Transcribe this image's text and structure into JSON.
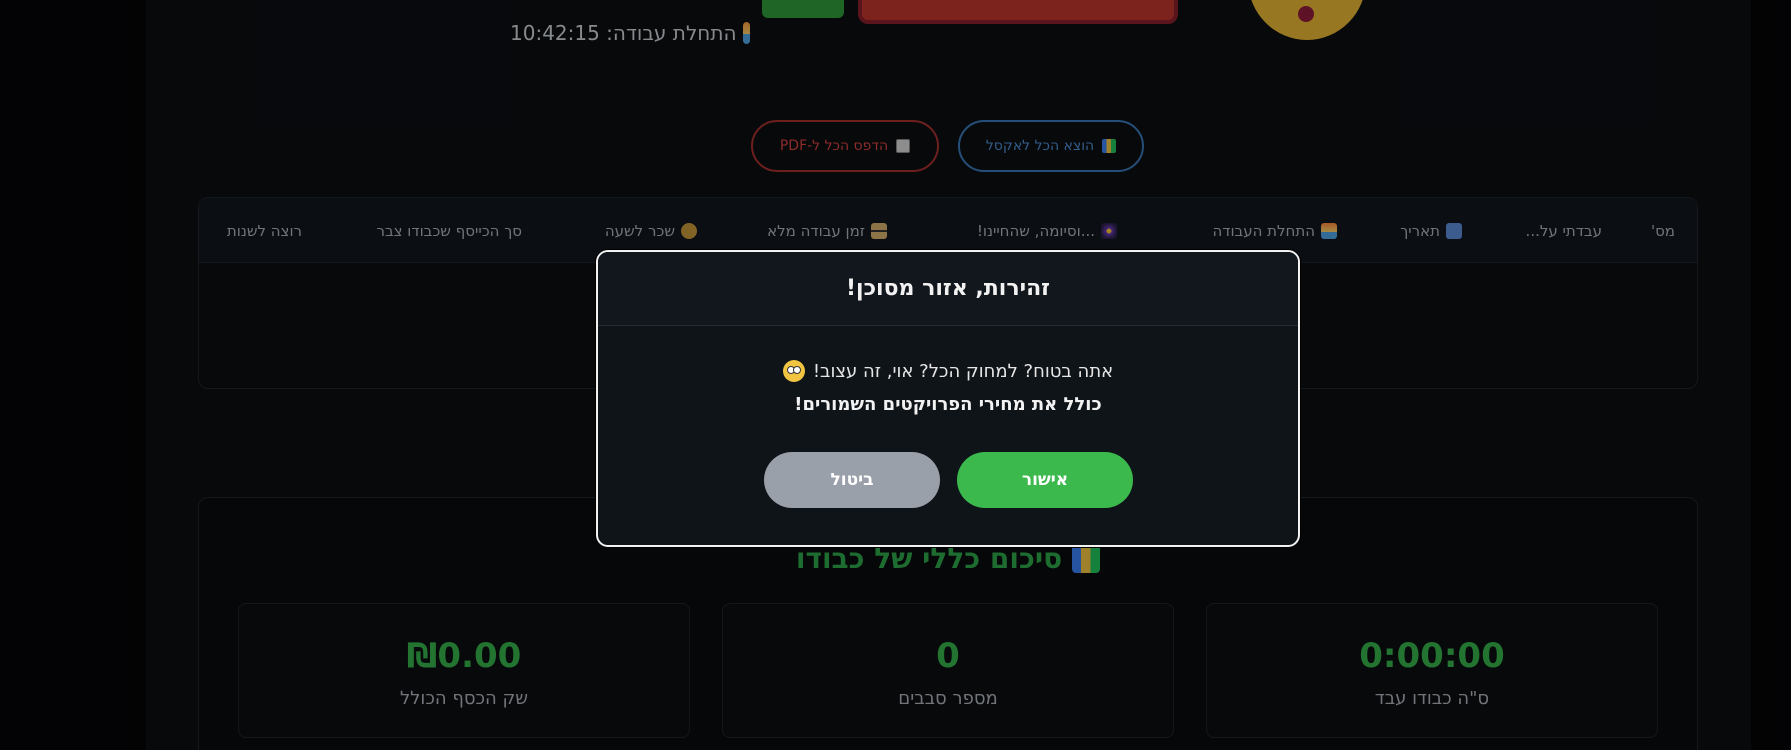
{
  "header": {
    "start_time_label": "התחלת עבודה: 10:42:15",
    "start_icon": "sunrise-icon"
  },
  "actions": {
    "export_excel": "הוצא הכל לאקסל",
    "export_pdf": "הדפס הכל ל-PDF"
  },
  "table": {
    "columns": [
      "מס'",
      "עבדתי על...",
      "תאריך",
      "התחלת העבודה",
      "...וסיומה, שהחיינו!",
      "זמן עבודה מלא",
      "שכר לשעה",
      "סך הכייסף שכבודו צבר",
      "רוצה לשנות"
    ]
  },
  "summary": {
    "title": "סיכום כללי של כבודו",
    "stats": [
      {
        "value": "0:00:00",
        "label": "ס\"ה כבודו עבד"
      },
      {
        "value": "0",
        "label": "מספר סבבים"
      },
      {
        "value": "₪0.00",
        "label": "שק הכסף הכולל"
      }
    ]
  },
  "modal": {
    "title": "זהירות, אזור מסוכן!",
    "line1": "אתה בטוח? למחוק הכל? אוי, זה עצוב!",
    "line2": "כולל את מחירי הפרויקטים השמורים!",
    "confirm": "אישור",
    "cancel": "ביטול"
  },
  "colors": {
    "accent_green": "#3bb94d",
    "danger": "#d9443f",
    "info": "#4f8fd4"
  }
}
